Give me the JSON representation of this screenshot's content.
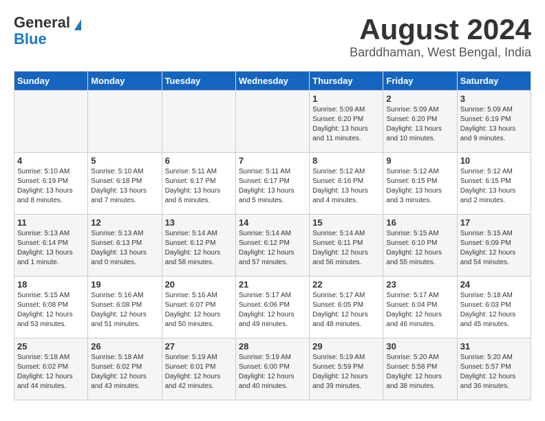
{
  "logo": {
    "line1": "General",
    "line2": "Blue"
  },
  "title": "August 2024",
  "location": "Barddhaman, West Bengal, India",
  "days_of_week": [
    "Sunday",
    "Monday",
    "Tuesday",
    "Wednesday",
    "Thursday",
    "Friday",
    "Saturday"
  ],
  "weeks": [
    [
      {
        "day": "",
        "content": ""
      },
      {
        "day": "",
        "content": ""
      },
      {
        "day": "",
        "content": ""
      },
      {
        "day": "",
        "content": ""
      },
      {
        "day": "1",
        "content": "Sunrise: 5:09 AM\nSunset: 6:20 PM\nDaylight: 13 hours\nand 11 minutes."
      },
      {
        "day": "2",
        "content": "Sunrise: 5:09 AM\nSunset: 6:20 PM\nDaylight: 13 hours\nand 10 minutes."
      },
      {
        "day": "3",
        "content": "Sunrise: 5:09 AM\nSunset: 6:19 PM\nDaylight: 13 hours\nand 9 minutes."
      }
    ],
    [
      {
        "day": "4",
        "content": "Sunrise: 5:10 AM\nSunset: 6:19 PM\nDaylight: 13 hours\nand 8 minutes."
      },
      {
        "day": "5",
        "content": "Sunrise: 5:10 AM\nSunset: 6:18 PM\nDaylight: 13 hours\nand 7 minutes."
      },
      {
        "day": "6",
        "content": "Sunrise: 5:11 AM\nSunset: 6:17 PM\nDaylight: 13 hours\nand 6 minutes."
      },
      {
        "day": "7",
        "content": "Sunrise: 5:11 AM\nSunset: 6:17 PM\nDaylight: 13 hours\nand 5 minutes."
      },
      {
        "day": "8",
        "content": "Sunrise: 5:12 AM\nSunset: 6:16 PM\nDaylight: 13 hours\nand 4 minutes."
      },
      {
        "day": "9",
        "content": "Sunrise: 5:12 AM\nSunset: 6:15 PM\nDaylight: 13 hours\nand 3 minutes."
      },
      {
        "day": "10",
        "content": "Sunrise: 5:12 AM\nSunset: 6:15 PM\nDaylight: 13 hours\nand 2 minutes."
      }
    ],
    [
      {
        "day": "11",
        "content": "Sunrise: 5:13 AM\nSunset: 6:14 PM\nDaylight: 13 hours\nand 1 minute."
      },
      {
        "day": "12",
        "content": "Sunrise: 5:13 AM\nSunset: 6:13 PM\nDaylight: 13 hours\nand 0 minutes."
      },
      {
        "day": "13",
        "content": "Sunrise: 5:14 AM\nSunset: 6:12 PM\nDaylight: 12 hours\nand 58 minutes."
      },
      {
        "day": "14",
        "content": "Sunrise: 5:14 AM\nSunset: 6:12 PM\nDaylight: 12 hours\nand 57 minutes."
      },
      {
        "day": "15",
        "content": "Sunrise: 5:14 AM\nSunset: 6:11 PM\nDaylight: 12 hours\nand 56 minutes."
      },
      {
        "day": "16",
        "content": "Sunrise: 5:15 AM\nSunset: 6:10 PM\nDaylight: 12 hours\nand 55 minutes."
      },
      {
        "day": "17",
        "content": "Sunrise: 5:15 AM\nSunset: 6:09 PM\nDaylight: 12 hours\nand 54 minutes."
      }
    ],
    [
      {
        "day": "18",
        "content": "Sunrise: 5:15 AM\nSunset: 6:08 PM\nDaylight: 12 hours\nand 53 minutes."
      },
      {
        "day": "19",
        "content": "Sunrise: 5:16 AM\nSunset: 6:08 PM\nDaylight: 12 hours\nand 51 minutes."
      },
      {
        "day": "20",
        "content": "Sunrise: 5:16 AM\nSunset: 6:07 PM\nDaylight: 12 hours\nand 50 minutes."
      },
      {
        "day": "21",
        "content": "Sunrise: 5:17 AM\nSunset: 6:06 PM\nDaylight: 12 hours\nand 49 minutes."
      },
      {
        "day": "22",
        "content": "Sunrise: 5:17 AM\nSunset: 6:05 PM\nDaylight: 12 hours\nand 48 minutes."
      },
      {
        "day": "23",
        "content": "Sunrise: 5:17 AM\nSunset: 6:04 PM\nDaylight: 12 hours\nand 46 minutes."
      },
      {
        "day": "24",
        "content": "Sunrise: 5:18 AM\nSunset: 6:03 PM\nDaylight: 12 hours\nand 45 minutes."
      }
    ],
    [
      {
        "day": "25",
        "content": "Sunrise: 5:18 AM\nSunset: 6:02 PM\nDaylight: 12 hours\nand 44 minutes."
      },
      {
        "day": "26",
        "content": "Sunrise: 5:18 AM\nSunset: 6:02 PM\nDaylight: 12 hours\nand 43 minutes."
      },
      {
        "day": "27",
        "content": "Sunrise: 5:19 AM\nSunset: 6:01 PM\nDaylight: 12 hours\nand 42 minutes."
      },
      {
        "day": "28",
        "content": "Sunrise: 5:19 AM\nSunset: 6:00 PM\nDaylight: 12 hours\nand 40 minutes."
      },
      {
        "day": "29",
        "content": "Sunrise: 5:19 AM\nSunset: 5:59 PM\nDaylight: 12 hours\nand 39 minutes."
      },
      {
        "day": "30",
        "content": "Sunrise: 5:20 AM\nSunset: 5:58 PM\nDaylight: 12 hours\nand 38 minutes."
      },
      {
        "day": "31",
        "content": "Sunrise: 5:20 AM\nSunset: 5:57 PM\nDaylight: 12 hours\nand 36 minutes."
      }
    ]
  ]
}
